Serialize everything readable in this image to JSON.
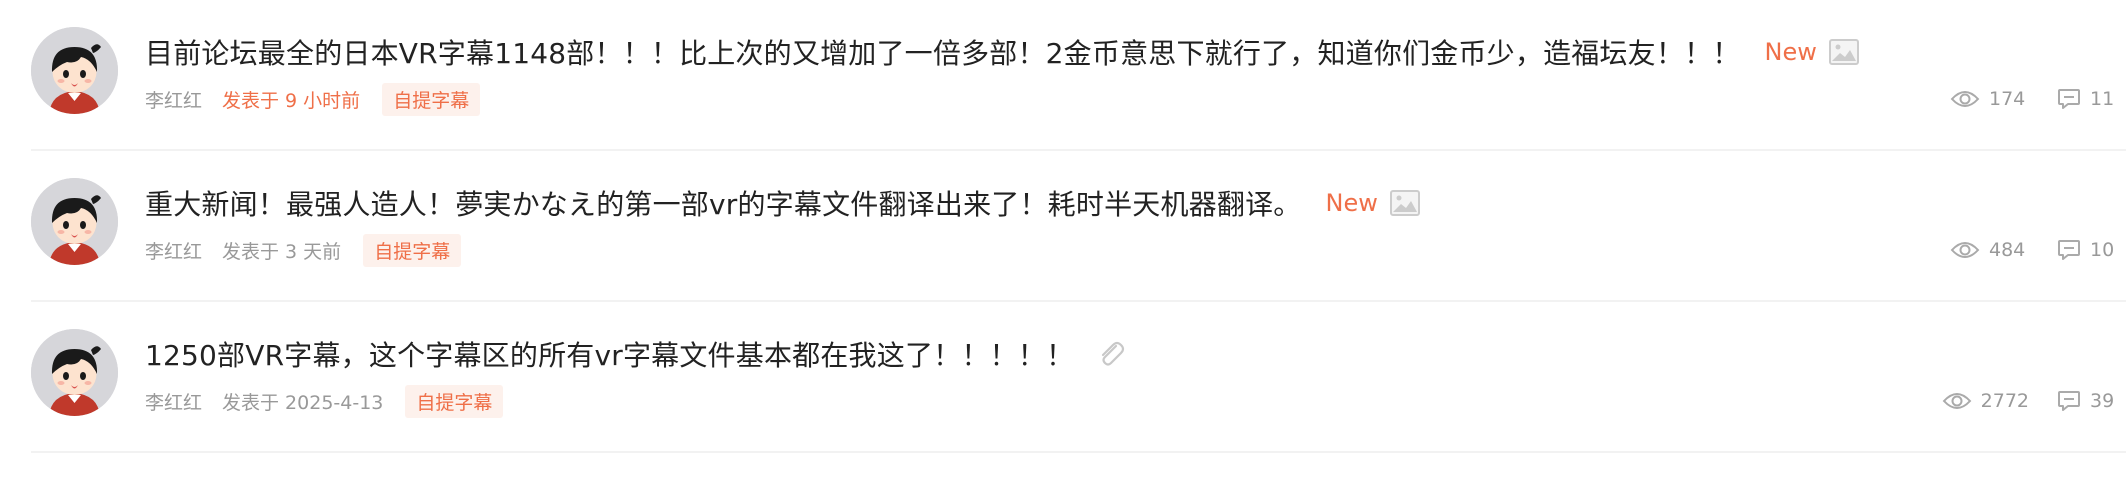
{
  "threads": [
    {
      "title": "目前论坛最全的日本VR字幕1148部！！！比上次的又增加了一倍多部！2金币意思下就行了，知道你们金币少，造福坛友！！！",
      "badge": "New",
      "icon": "image-icon",
      "author": "李红红",
      "time": "发表于 9 小时前",
      "tag": "自提字幕",
      "views": "174",
      "replies": "11"
    },
    {
      "title": "重大新闻！最强人造人！夢実かなえ的第一部vr的字幕文件翻译出来了！耗时半天机器翻译。",
      "badge": "New",
      "icon": "image-icon",
      "author": "李红红",
      "time": "发表于 3 天前",
      "tag": "自提字幕",
      "views": "484",
      "replies": "10"
    },
    {
      "title": "1250部VR字幕，这个字幕区的所有vr字幕文件基本都在我这了！！！！！",
      "badge": "",
      "icon": "attachment-icon",
      "author": "李红红",
      "time": "发表于 2025-4-13",
      "tag": "自提字幕",
      "views": "2772",
      "replies": "39"
    }
  ],
  "colors": {
    "accent": "#ef6f48",
    "tag_background": "#fdf1ec",
    "muted_text": "#999999",
    "title_text": "#222222",
    "divider": "#f2f2f2"
  }
}
